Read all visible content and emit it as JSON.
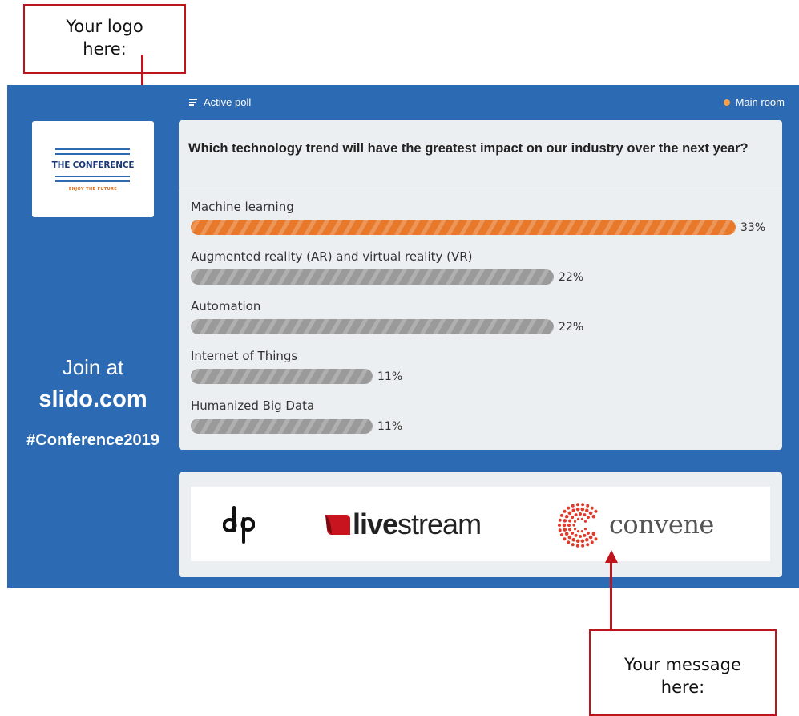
{
  "callouts": {
    "logo": {
      "line1": "Your logo",
      "line2": "here:"
    },
    "message": {
      "line1": "Your message",
      "line2": "here:"
    }
  },
  "slide": {
    "header": {
      "left_label": "Active poll",
      "right_label": "Main room"
    },
    "logo_card": {
      "title": "THE CONFERENCE",
      "subtitle": "ENJOY THE FUTURE"
    },
    "join": {
      "line1": "Join at",
      "line2": "slido.com",
      "line3": "#Conference2019"
    },
    "poll": {
      "question": "Which technology trend will have the greatest impact on our industry over the next year?",
      "options": [
        {
          "label": "Machine learning",
          "percent": 33,
          "percent_label": "33%",
          "leader": true
        },
        {
          "label": "Augmented reality (AR) and virtual reality (VR)",
          "percent": 22,
          "percent_label": "22%",
          "leader": false
        },
        {
          "label": "Automation",
          "percent": 22,
          "percent_label": "22%",
          "leader": false
        },
        {
          "label": "Internet of Things",
          "percent": 11,
          "percent_label": "11%",
          "leader": false
        },
        {
          "label": "Humanized Big Data",
          "percent": 11,
          "percent_label": "11%",
          "leader": false
        }
      ]
    },
    "sponsors": {
      "livestream_bold": "live",
      "livestream_rest": "stream",
      "convene": "convene"
    }
  },
  "colors": {
    "slide_bg": "#2c6bb4",
    "leader_bar": "#e8792a",
    "other_bar": "#9a9a9a",
    "callout_border": "#c0141c",
    "livestream_red": "#c8141e",
    "convene_red": "#e03a2a"
  }
}
